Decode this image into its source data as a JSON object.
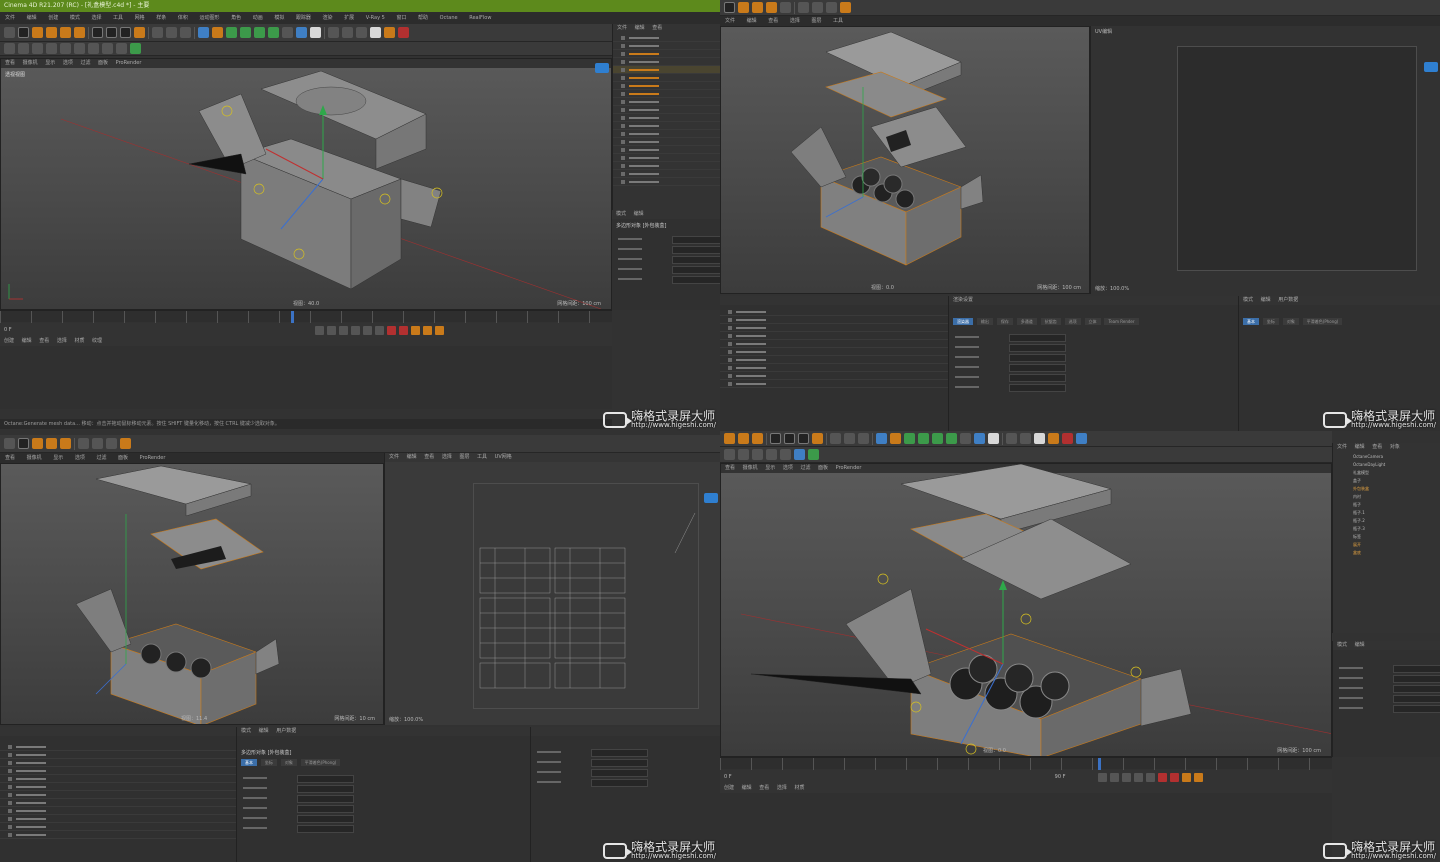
{
  "window": {
    "title": "Cinema 4D R21.207 (RC) - [礼盒模型.c4d *] - 主要"
  },
  "menu": {
    "items": [
      "文件",
      "编辑",
      "创建",
      "模式",
      "选择",
      "工具",
      "网格",
      "样条",
      "体积",
      "运动图形",
      "角色",
      "动画",
      "模拟",
      "跟踪器",
      "渲染",
      "扩展",
      "V-Ray 5",
      "窗口",
      "帮助",
      "Octane",
      "RealFlow"
    ]
  },
  "layout": {
    "label": "界面：启动"
  },
  "viewport_tabs": [
    "查看",
    "摄像机",
    "显示",
    "选项",
    "过滤",
    "面板",
    "ProRender"
  ],
  "viewport_name": "透视视图",
  "hud": {
    "q1_grid": "网格间距：100 cm",
    "q1_view": "视图：40.0",
    "q2_grid": "网格间距：100 cm",
    "q2_view": "视图：0.0",
    "q3_grid": "网格间距：10 cm",
    "q3_view": "视图：11.4",
    "q4_grid": "网格间距：100 cm",
    "q4_view": "视图：0.0",
    "uv_zoom": "缩放：100.0%"
  },
  "timeline": {
    "ticks": [
      "0",
      "5",
      "10",
      "15",
      "20",
      "25",
      "30",
      "35",
      "40",
      "45",
      "50",
      "55",
      "60",
      "65",
      "70",
      "75",
      "80",
      "85",
      "90"
    ],
    "current_frame": "0 F",
    "end_frame": "90 F",
    "frame_label": "45 F"
  },
  "object_manager": {
    "tabs": [
      "文件",
      "编辑",
      "查看",
      "对象",
      "标签",
      "书签"
    ],
    "items": [
      "OctaneCamera",
      "OctaneDayLight",
      "礼盒模型",
      "盖子",
      "外包装盒",
      "内衬",
      "瓶子",
      "瓶子.1",
      "瓶子.2",
      "瓶子.3",
      "标签",
      "展开",
      "盒底"
    ]
  },
  "attribute_manager": {
    "tabs": [
      "模式",
      "编辑",
      "用户数据"
    ],
    "title": "多边形对象 [外包装盒]",
    "sections": [
      "基本",
      "坐标",
      "对象",
      "平滑着色(Phong)"
    ],
    "fields": [
      "名称",
      "图层",
      "编辑器可见",
      "渲染器可见",
      "使用颜色",
      "显示颜色"
    ]
  },
  "material_panel": {
    "tabs": [
      "创建",
      "编辑",
      "查看",
      "选择",
      "材质",
      "纹理"
    ]
  },
  "uv_view": {
    "tabs": [
      "UV编辑",
      "文件",
      "编辑",
      "查看",
      "选择",
      "图层",
      "工具",
      "UV网格"
    ],
    "label": "UV编辑"
  },
  "render_settings": {
    "tabs": [
      "渲染器",
      "输出",
      "保存",
      "多通道",
      "抗锯齿",
      "选项",
      "立体",
      "Team Render",
      "材质覆写"
    ],
    "title": "渲染设置"
  },
  "watermark": {
    "brand": "嗨格式录屏大师",
    "url": "http://www.higeshi.com/"
  },
  "status": {
    "text": "Octane:Generate mesh data... 移动：点击并拖动鼠标移动元素。按住 SHIFT 键量化移动，按住 CTRL 键减少选取对象。"
  }
}
